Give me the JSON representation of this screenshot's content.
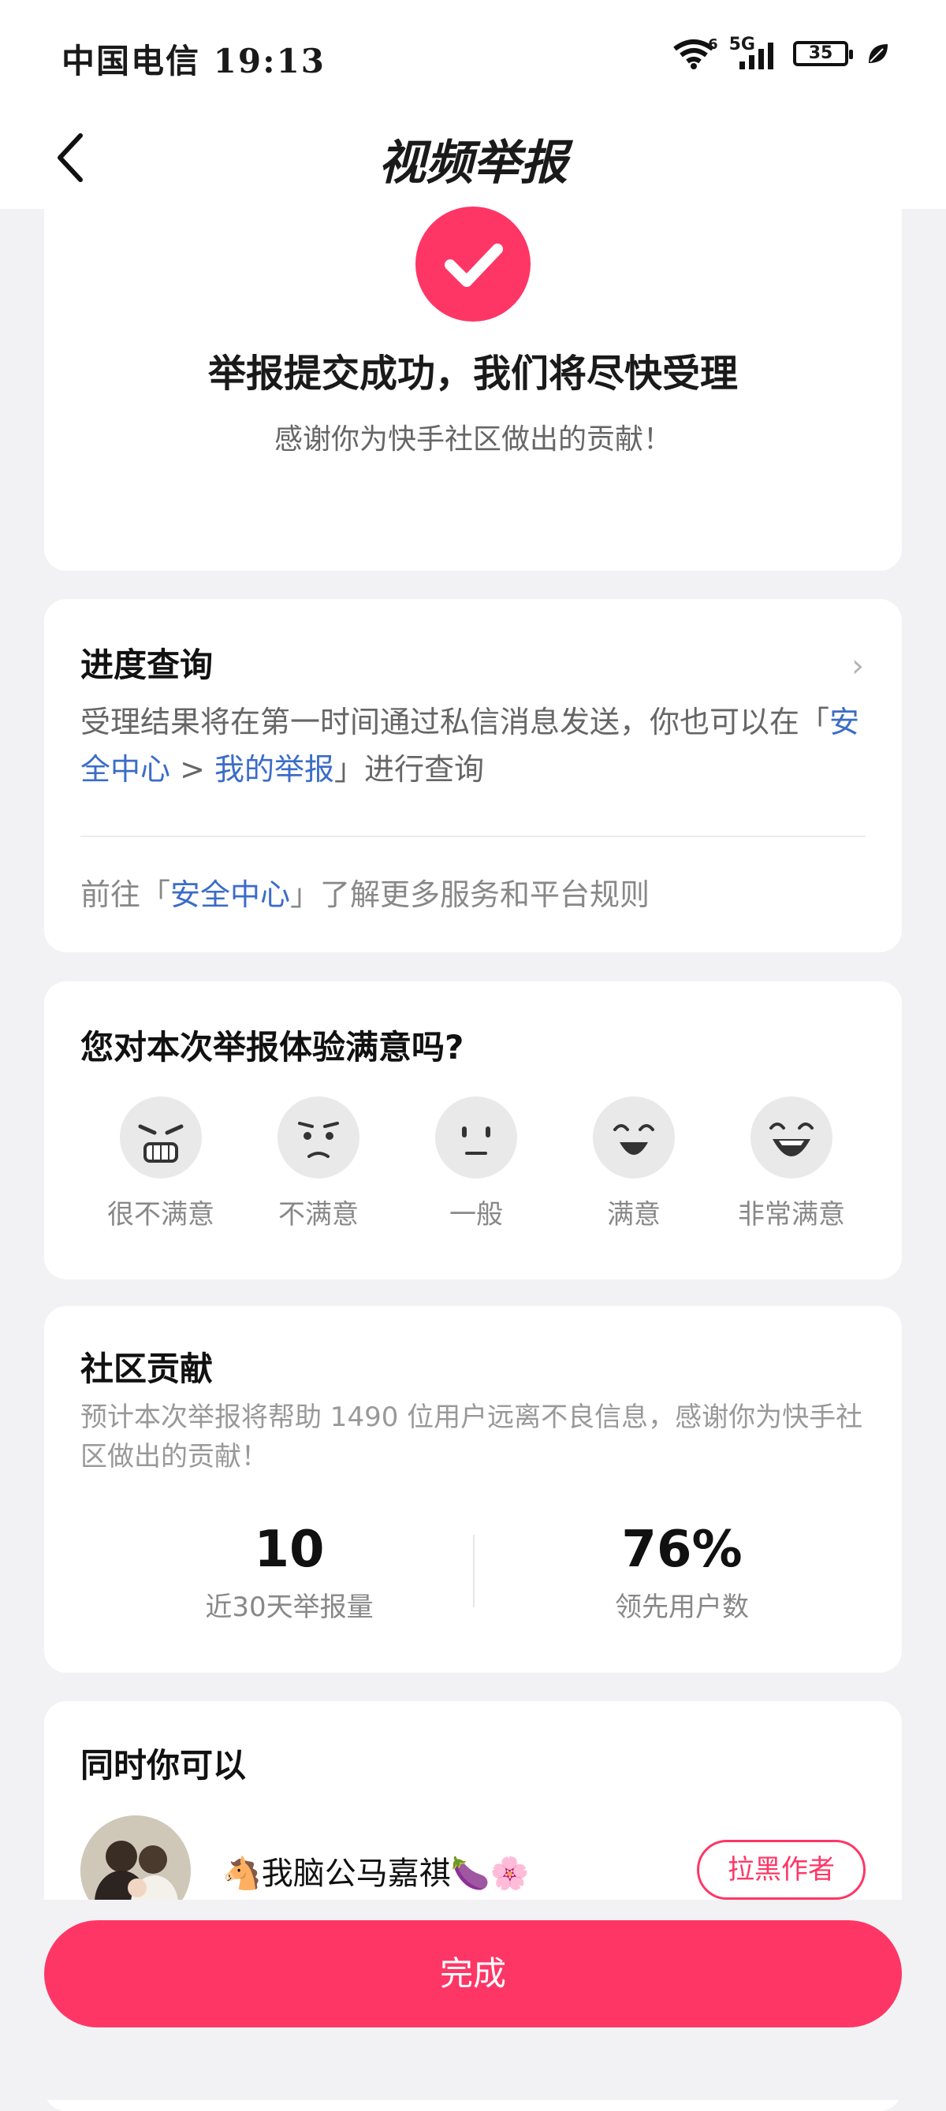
{
  "status_bar": {
    "carrier_time": "中国电信 19:13",
    "signal_labels": [
      "6",
      "5G"
    ],
    "battery": "35",
    "icons": [
      "wifi-icon",
      "signal-bars-icon",
      "battery-icon",
      "leaf-icon"
    ]
  },
  "nav": {
    "title": "视频举报",
    "back_icon": "chevron-left-icon"
  },
  "success": {
    "title": "举报提交成功，我们将尽快受理",
    "subtitle": "感谢你为快手社区做出的贡献！"
  },
  "progress": {
    "title": "进度查询",
    "desc_prefix": "受理结果将在第一时间通过私信消息发送，你也可以在「",
    "link1": "安全中心",
    "separator": " > ",
    "link2": "我的举报",
    "desc_suffix": "」进行查询",
    "goto_prefix": "前往「",
    "goto_link": "安全中心",
    "goto_suffix": "」了解更多服务和平台规则"
  },
  "survey": {
    "title": "您对本次举报体验满意吗?",
    "options": [
      {
        "label": "很不满意",
        "icon": "very-unsatisfied-face-icon"
      },
      {
        "label": "不满意",
        "icon": "unsatisfied-face-icon"
      },
      {
        "label": "一般",
        "icon": "neutral-face-icon"
      },
      {
        "label": "满意",
        "icon": "satisfied-face-icon"
      },
      {
        "label": "非常满意",
        "icon": "very-satisfied-face-icon"
      }
    ]
  },
  "contribution": {
    "title": "社区贡献",
    "desc": "预计本次举报将帮助 1490 位用户远离不良信息，感谢你为快手社区做出的贡献！",
    "stats": [
      {
        "value": "10",
        "label": "近30天举报量"
      },
      {
        "value": "76%",
        "label": "领先用户数"
      }
    ]
  },
  "more": {
    "title": "同时你可以",
    "author_name": "🐴我脑公马嘉祺🍆🌸",
    "block_label": "拉黑作者"
  },
  "done_label": "完成",
  "colors": {
    "accent": "#fe3666",
    "link": "#3b6cc8"
  }
}
